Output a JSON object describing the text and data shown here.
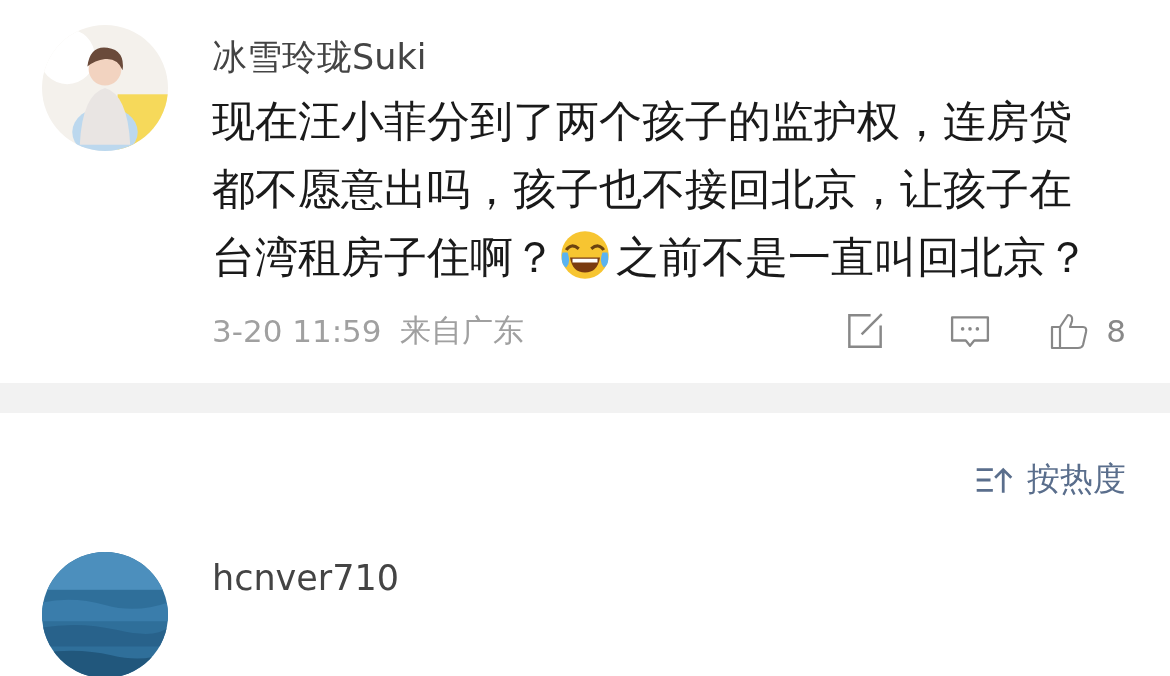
{
  "comments": [
    {
      "username": "冰雪玲珑Suki",
      "body": [
        {
          "kind": "text",
          "text": "现在汪小菲分到了两个孩子的监护权，连房贷都不愿意出吗，孩子也不接回北京，让孩子在台湾租房子住啊？"
        },
        {
          "kind": "emoji"
        },
        {
          "kind": "text",
          "text": "之前不是一直叫回北京？"
        }
      ],
      "time": "3-20 11:59",
      "location": "来自广东",
      "likes": "8"
    }
  ],
  "sort": {
    "label": "按热度"
  },
  "next_comment": {
    "username": "hcnver710"
  }
}
